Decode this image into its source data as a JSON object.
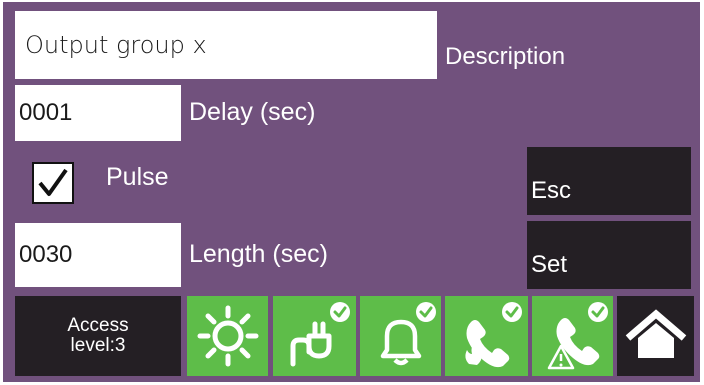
{
  "description": {
    "value": "Output group x",
    "label": "Description"
  },
  "delay": {
    "value": "0001",
    "label": "Delay (sec)"
  },
  "pulse": {
    "label": "Pulse",
    "checked": true
  },
  "length": {
    "value": "0030",
    "label": "Length (sec)"
  },
  "buttons": {
    "esc": "Esc",
    "set": "Set"
  },
  "footer": {
    "access_line1": "Access",
    "access_line2": "level:3",
    "icons": [
      "sun-icon",
      "power-plug-icon",
      "bell-icon",
      "phone-fire-icon",
      "phone-warning-icon",
      "home-icon"
    ]
  },
  "colors": {
    "background": "#71517d",
    "field": "#ffffff",
    "dark_button": "#241f24",
    "status_tile": "#5ebd49"
  }
}
